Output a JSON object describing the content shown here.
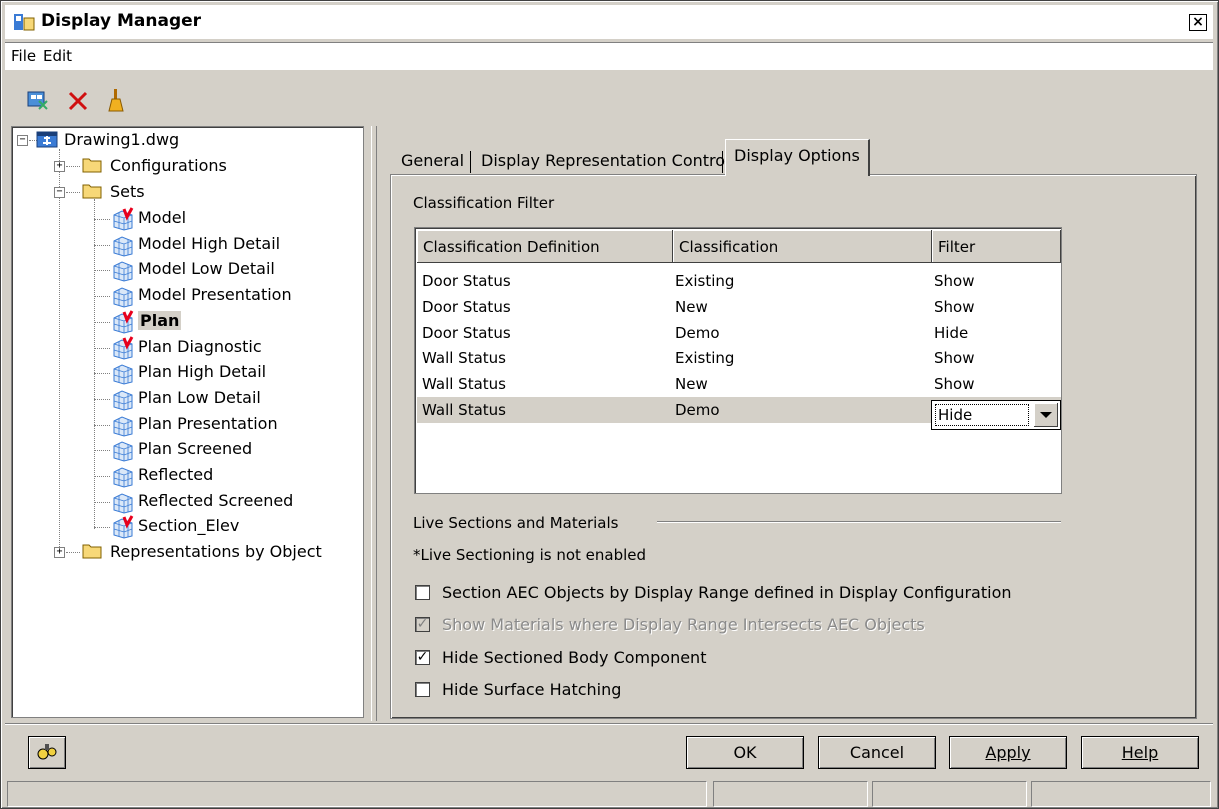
{
  "window": {
    "title": "Display Manager",
    "close_label": "×"
  },
  "menu": {
    "items": [
      "File",
      "Edit"
    ]
  },
  "toolbar": {
    "icons": [
      "purge-icon",
      "delete-icon",
      "broom-icon"
    ]
  },
  "tree": {
    "root": "Drawing1.dwg",
    "configurations": "Configurations",
    "sets": "Sets",
    "set_items": [
      {
        "label": "Model",
        "marked": true
      },
      {
        "label": "Model High Detail",
        "marked": false
      },
      {
        "label": "Model Low Detail",
        "marked": false
      },
      {
        "label": "Model Presentation",
        "marked": false
      },
      {
        "label": "Plan",
        "marked": true,
        "selected": true
      },
      {
        "label": "Plan Diagnostic",
        "marked": true
      },
      {
        "label": "Plan High Detail",
        "marked": false
      },
      {
        "label": "Plan Low Detail",
        "marked": false
      },
      {
        "label": "Plan Presentation",
        "marked": false
      },
      {
        "label": "Plan Screened",
        "marked": false
      },
      {
        "label": "Reflected",
        "marked": false
      },
      {
        "label": "Reflected Screened",
        "marked": false
      },
      {
        "label": "Section_Elev",
        "marked": true
      }
    ],
    "representations": "Representations by Object"
  },
  "tabs": [
    "General",
    "Display Representation Control",
    "Display Options"
  ],
  "active_tab": "Display Options",
  "classification": {
    "group_label": "Classification Filter",
    "headers": [
      "Classification Definition",
      "Classification",
      "Filter"
    ],
    "rows": [
      [
        "Door Status",
        "Existing",
        "Show"
      ],
      [
        "Door Status",
        "New",
        "Show"
      ],
      [
        "Door Status",
        "Demo",
        "Hide"
      ],
      [
        "Wall Status",
        "Existing",
        "Show"
      ],
      [
        "Wall Status",
        "New",
        "Show"
      ],
      [
        "Wall Status",
        "Demo",
        "Hide"
      ]
    ],
    "selected_row": 5
  },
  "live_sections": {
    "group_label": "Live Sections and Materials",
    "note": "*Live Sectioning is not enabled",
    "options": [
      {
        "label": "Section AEC Objects by Display Range defined in Display Configuration",
        "checked": false,
        "enabled": true
      },
      {
        "label": "Show Materials where Display Range Intersects AEC Objects",
        "checked": true,
        "enabled": false
      },
      {
        "label": "Hide Sectioned Body Component",
        "checked": true,
        "enabled": true
      },
      {
        "label": "Hide Surface Hatching",
        "checked": false,
        "enabled": true
      }
    ]
  },
  "buttons": {
    "ok": "OK",
    "cancel": "Cancel",
    "apply": "Apply",
    "help": "Help"
  },
  "colors": {
    "face": "#d4d0c8",
    "marker": "#e8001c",
    "folder": "#f7d878",
    "cube": "#3a7bd5"
  }
}
